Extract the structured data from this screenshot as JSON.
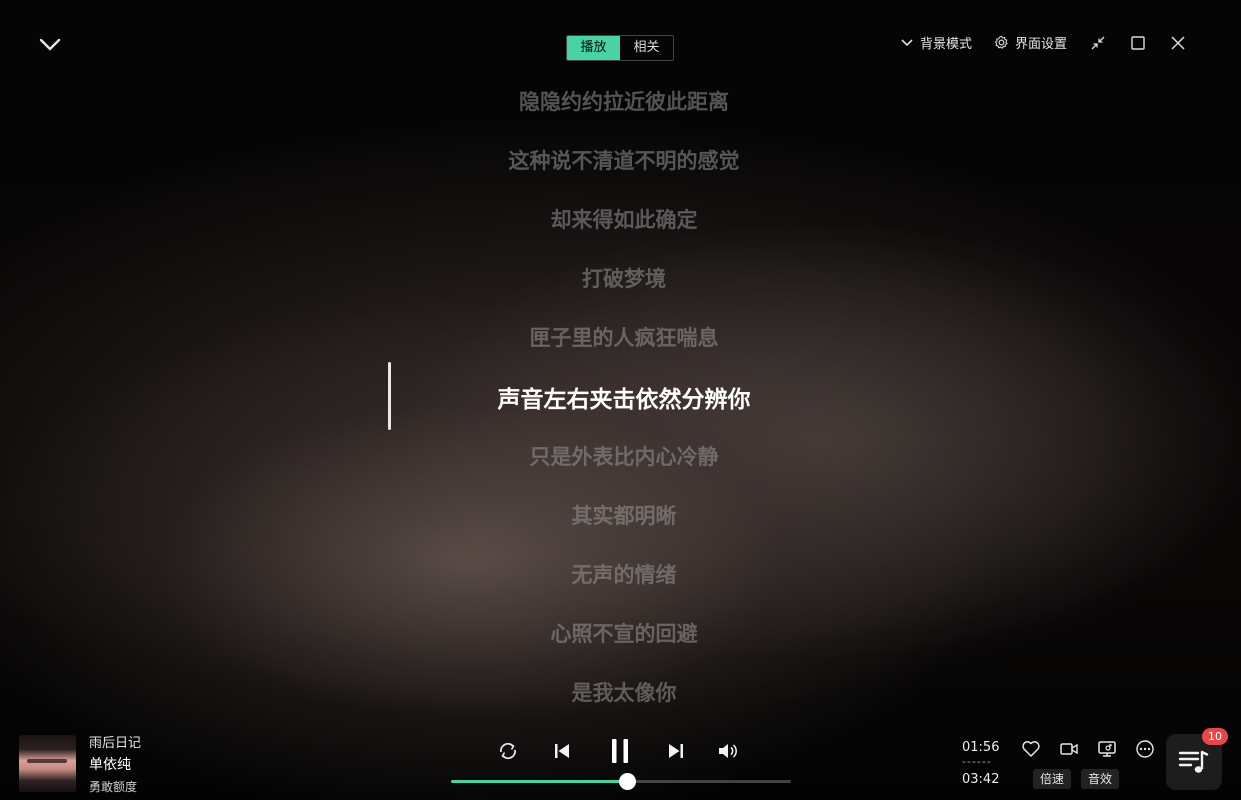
{
  "header": {
    "tabs": [
      {
        "label": "播放",
        "active": true
      },
      {
        "label": "相关",
        "active": false
      }
    ],
    "bg_mode_label": "背景模式",
    "ui_settings_label": "界面设置"
  },
  "lyrics": {
    "lines": [
      "隐隐约约拉近彼此距离",
      "这种说不清道不明的感觉",
      "却来得如此确定",
      "打破梦境",
      "匣子里的人疯狂喘息",
      "声音左右夹击依然分辨你",
      "只是外表比内心冷静",
      "其实都明晰",
      "无声的情绪",
      "心照不宣的回避",
      "是我太像你"
    ],
    "current_index": 5
  },
  "player": {
    "song_title": "雨后日记",
    "artist": "单依纯",
    "subtitle": "勇敢额度",
    "current_time": "01:56",
    "separator": "------",
    "total_time": "03:42",
    "progress": 0.52,
    "speed_label": "倍速",
    "effect_label": "音效",
    "playlist_count": "10"
  },
  "colors": {
    "accent": "#49d3a2",
    "badge": "#e5474b"
  }
}
